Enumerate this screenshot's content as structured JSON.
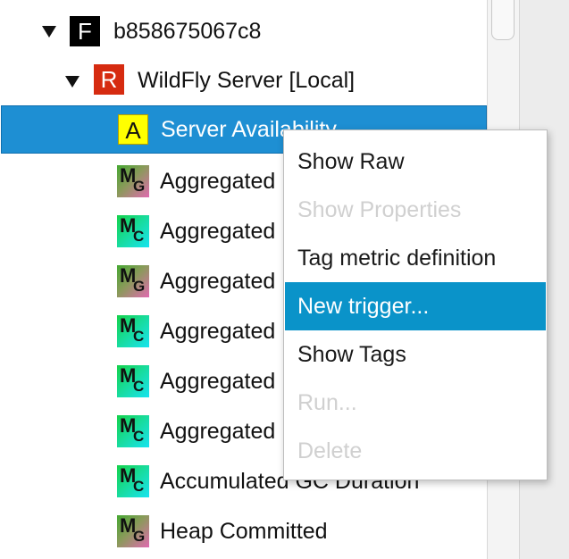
{
  "tree": {
    "root": {
      "badge": "F",
      "label": "b858675067c8"
    },
    "server": {
      "badge": "R",
      "label": "WildFly Server [Local]"
    },
    "items": [
      {
        "badge": "A",
        "sub": "",
        "label": "Server Availability",
        "selected": true
      },
      {
        "badge": "M",
        "sub": "G",
        "label": "Aggregated"
      },
      {
        "badge": "M",
        "sub": "C",
        "label": "Aggregated"
      },
      {
        "badge": "M",
        "sub": "G",
        "label": "Aggregated"
      },
      {
        "badge": "M",
        "sub": "C",
        "label": "Aggregated"
      },
      {
        "badge": "M",
        "sub": "C",
        "label": "Aggregated"
      },
      {
        "badge": "M",
        "sub": "C",
        "label": "Aggregated"
      },
      {
        "badge": "M",
        "sub": "C",
        "label": "Accumulated GC Duration"
      },
      {
        "badge": "M",
        "sub": "G",
        "label": "Heap Committed"
      }
    ]
  },
  "context_menu": {
    "items": [
      {
        "label": "Show Raw",
        "state": "enabled"
      },
      {
        "label": "Show Properties",
        "state": "disabled"
      },
      {
        "label": "Tag metric definition",
        "state": "enabled"
      },
      {
        "label": "New trigger...",
        "state": "highlighted"
      },
      {
        "label": "Show Tags",
        "state": "enabled"
      },
      {
        "label": "Run...",
        "state": "disabled"
      },
      {
        "label": "Delete",
        "state": "disabled"
      }
    ]
  },
  "colors": {
    "selection": "#1e8fd3",
    "menu_highlight": "#0a93c9",
    "badge_f": "#000000",
    "badge_r": "#d62b10",
    "badge_a": "#ffff00"
  }
}
